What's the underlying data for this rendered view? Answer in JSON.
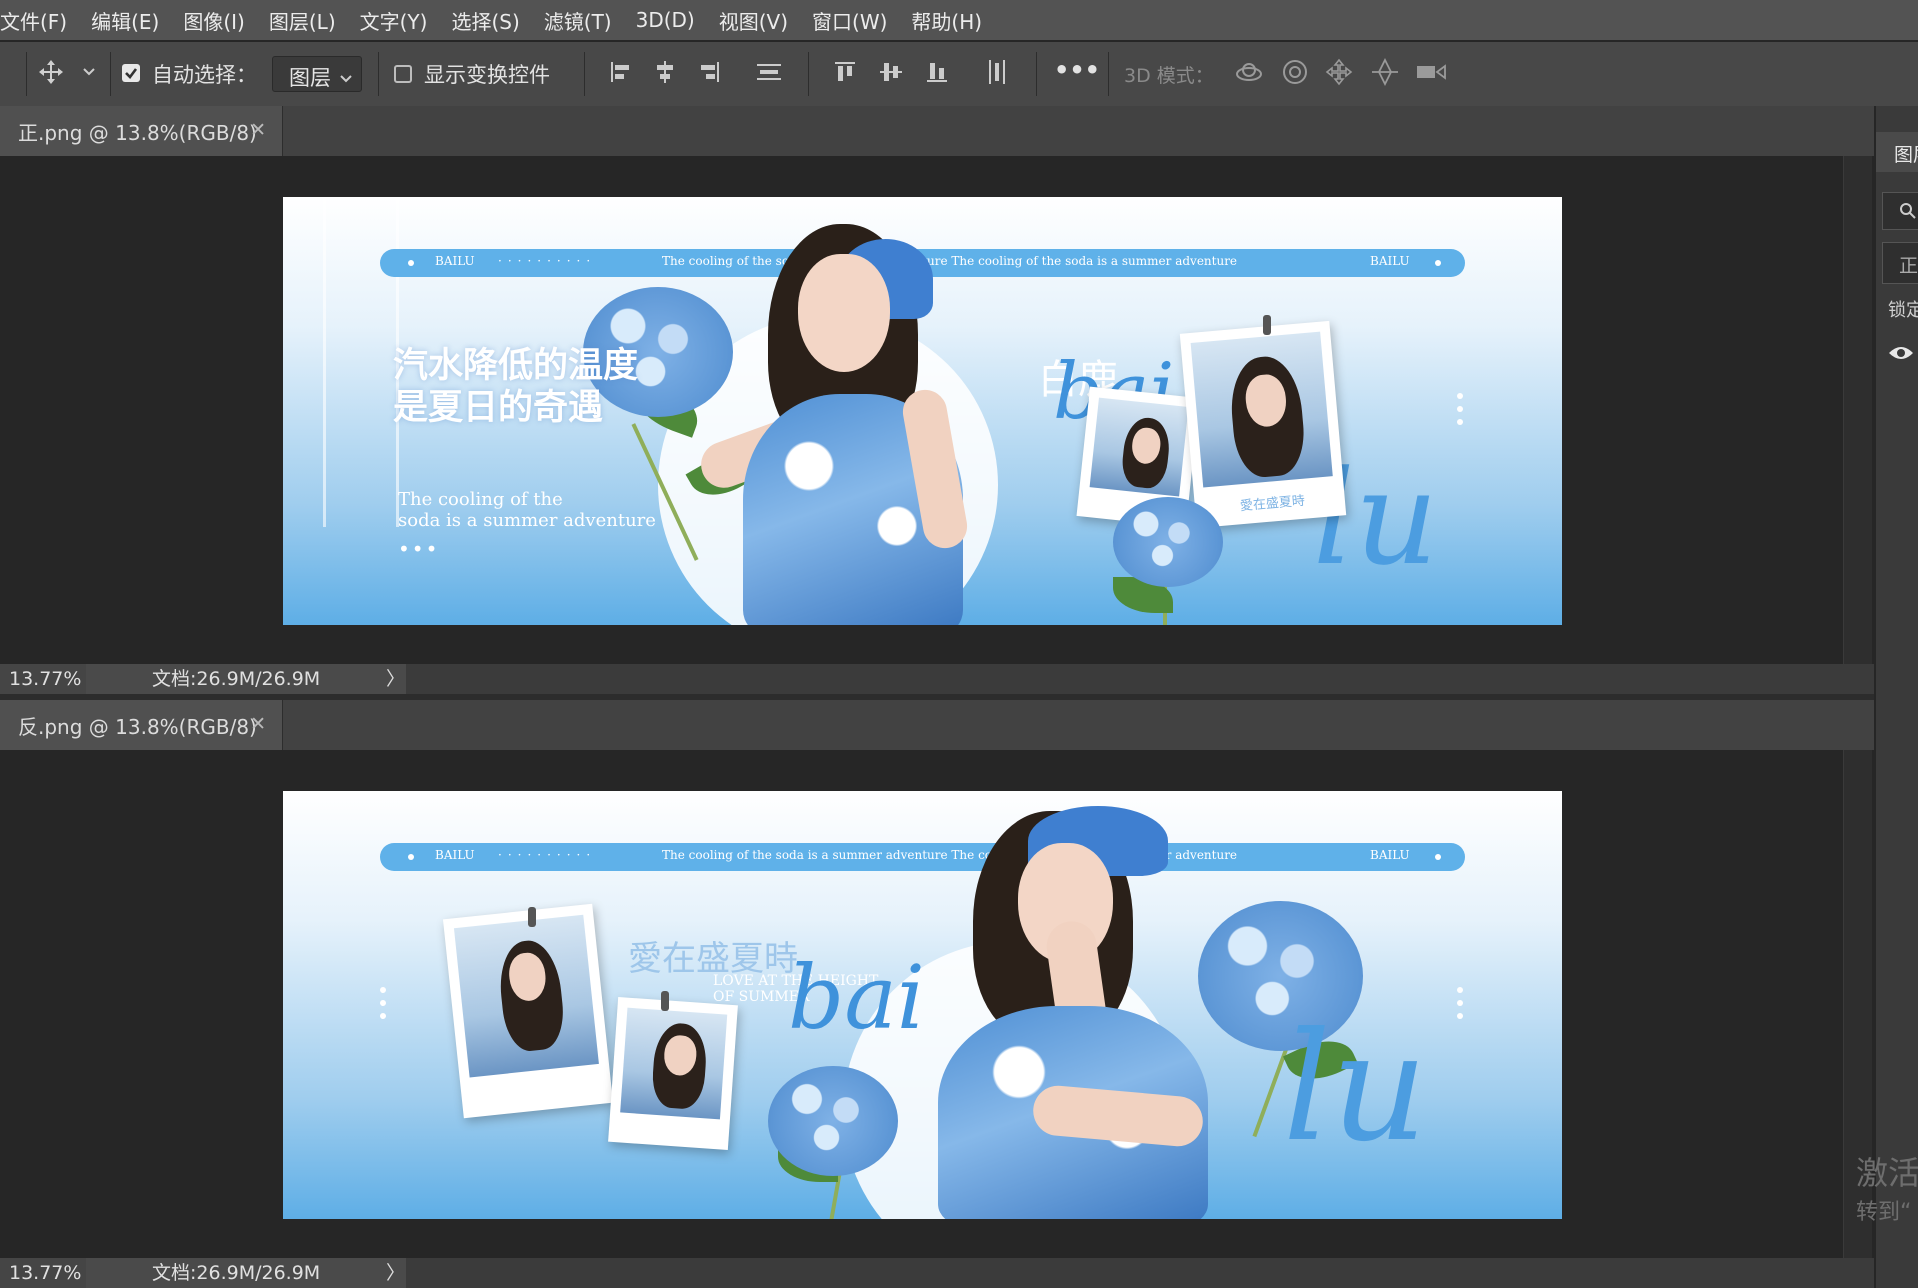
{
  "menu": [
    "文件(F)",
    "编辑(E)",
    "图像(I)",
    "图层(L)",
    "文字(Y)",
    "选择(S)",
    "滤镜(T)",
    "3D(D)",
    "视图(V)",
    "窗口(W)",
    "帮助(H)"
  ],
  "options_bar": {
    "auto_select_label": "自动选择：",
    "auto_select_checked": true,
    "layer_select_value": "图层",
    "show_transform_label": "显示变换控件",
    "show_transform_checked": false,
    "more_label": "•••",
    "mode_3d_label": "3D 模式："
  },
  "documents": [
    {
      "tab_title": "正.png @ 13.8%(RGB/8)",
      "zoom": "13.77%",
      "doc_info": "文档:26.9M/26.9M",
      "banner": {
        "strip_left": "BAILU",
        "strip_mid": "The cooling of the soda is a summer adventure The cooling of the soda is a summer adventure",
        "strip_right": "BAILU",
        "headline_1": "汽水降低的温度",
        "headline_2": "是夏日的奇遇",
        "subline_1": "The cooling of the",
        "subline_2": "soda is a summer adventure",
        "name_cn": "白鹿",
        "script_1": "bai",
        "script_2": "lu",
        "polaroid_caption": "愛在盛夏時"
      }
    },
    {
      "tab_title": "反.png @ 13.8%(RGB/8)",
      "zoom": "13.77%",
      "doc_info": "文档:26.9M/26.9M",
      "banner": {
        "strip_left": "BAILU",
        "strip_mid": "The cooling of the soda is a summer adventure The cooling of the soda is a summer adventure",
        "strip_right": "BAILU",
        "title_cn": "愛在盛夏時",
        "sub_en_1": "LOVE AT THE HEIGHT",
        "sub_en_2": "OF SUMMER",
        "script_1": "bai",
        "script_2": "lu"
      }
    }
  ],
  "right_panel": {
    "tab_label": "图层",
    "mini_label": "正",
    "lock_label": "锁定"
  },
  "watermark": {
    "line1": "激活",
    "line2": "转到“"
  },
  "icons": [
    "move-tool-icon",
    "chevron-down-icon",
    "align-left-icon",
    "align-center-icon",
    "align-right-icon",
    "distribute-icon",
    "align-top-icon",
    "align-middle-icon",
    "align-bottom-icon",
    "distribute-vertical-icon",
    "orbit-3d-icon",
    "roll-3d-icon",
    "drag-3d-icon",
    "slide-3d-icon",
    "camera-3d-icon",
    "search-icon",
    "eye-icon",
    "close-icon"
  ],
  "colors": {
    "ui_dark": "#262626",
    "menu_bg": "#535353",
    "banner_blue": "#5eaee6",
    "accent_blue": "#3f92db"
  }
}
